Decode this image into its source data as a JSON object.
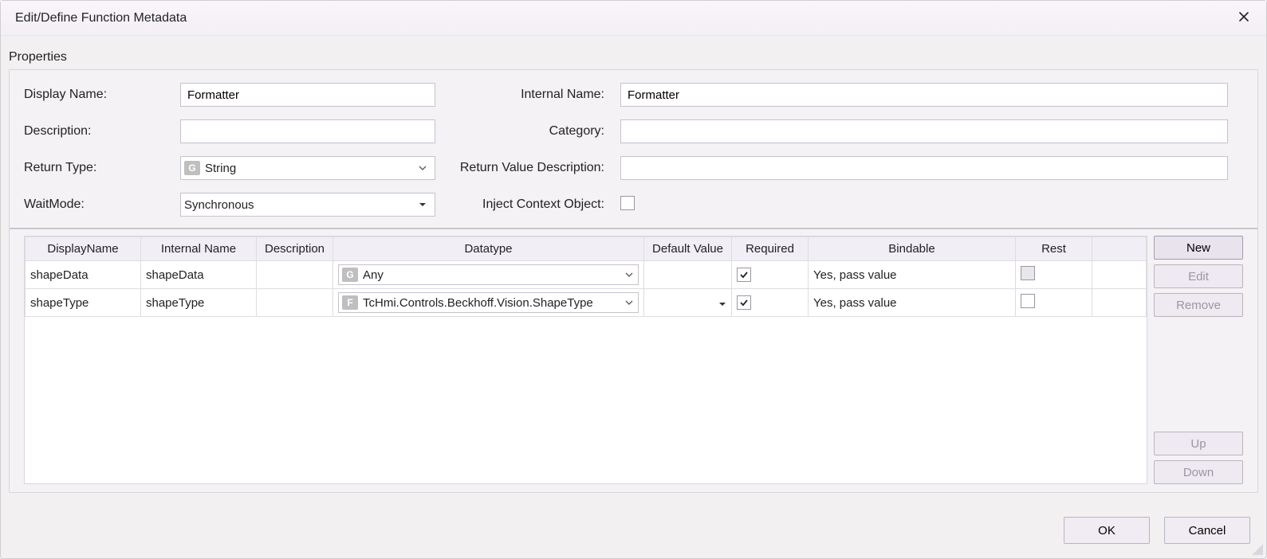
{
  "window": {
    "title": "Edit/Define Function Metadata"
  },
  "section_label": "Properties",
  "labels": {
    "displayName": "Display Name:",
    "internalName": "Internal Name:",
    "description": "Description:",
    "category": "Category:",
    "returnType": "Return Type:",
    "returnValueDesc": "Return Value Description:",
    "waitMode": "WaitMode:",
    "injectContext": "Inject Context Object:"
  },
  "form": {
    "displayName": "Formatter",
    "internalName": "Formatter",
    "description": "",
    "category": "",
    "returnType": {
      "badge": "G",
      "text": "String"
    },
    "returnValueDesc": "",
    "waitMode": "Synchronous",
    "injectContext": false
  },
  "grid": {
    "headers": {
      "displayName": "DisplayName",
      "internalName": "Internal Name",
      "description": "Description",
      "datatype": "Datatype",
      "defaultValue": "Default Value",
      "required": "Required",
      "bindable": "Bindable",
      "rest": "Rest"
    },
    "rows": [
      {
        "displayName": "shapeData",
        "internalName": "shapeData",
        "description": "",
        "datatype": {
          "badge": "G",
          "text": "Any",
          "hasCaret": true,
          "defaultCaret": false
        },
        "defaultValue": "",
        "required": true,
        "bindable": "Yes, pass value",
        "rest": "disabled"
      },
      {
        "displayName": "shapeType",
        "internalName": "shapeType",
        "description": "",
        "datatype": {
          "badge": "F",
          "text": "TcHmi.Controls.Beckhoff.Vision.ShapeType",
          "hasCaret": true,
          "defaultCaret": true
        },
        "defaultValue": "",
        "required": true,
        "bindable": "Yes, pass value",
        "rest": "unchecked"
      }
    ]
  },
  "buttons": {
    "new": "New",
    "edit": "Edit",
    "remove": "Remove",
    "up": "Up",
    "down": "Down",
    "ok": "OK",
    "cancel": "Cancel"
  }
}
